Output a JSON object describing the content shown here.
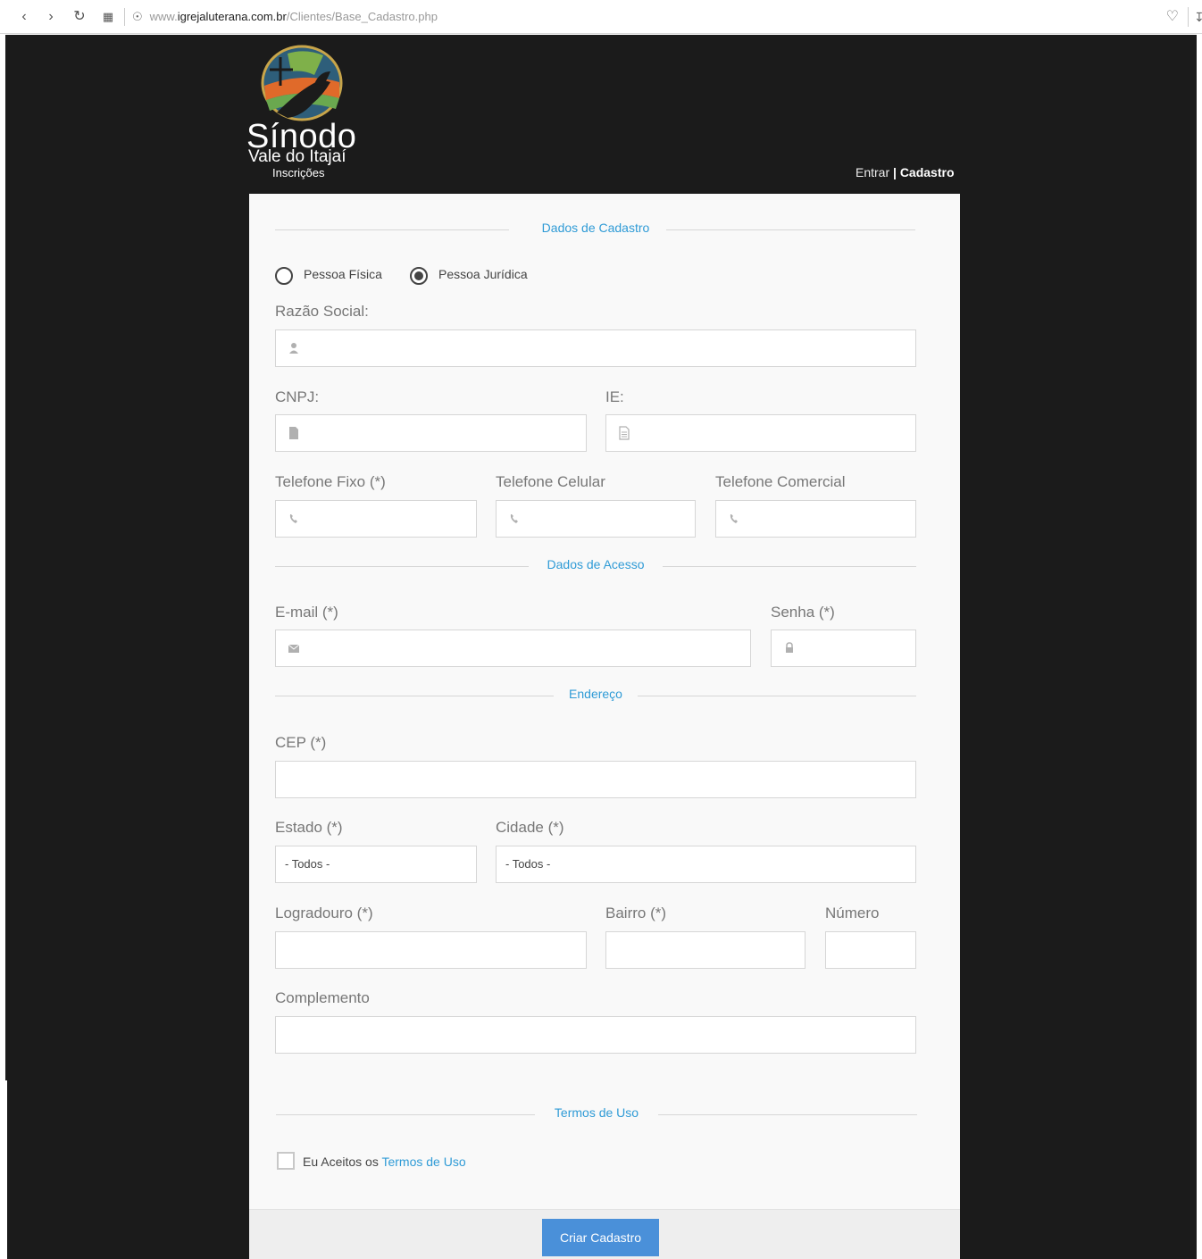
{
  "browser": {
    "url_prefix": "www.",
    "url_domain": "igrejaluterana.com.br",
    "url_path": "/Clientes/Base_Cadastro.php"
  },
  "header": {
    "logo_title": "Sínodo",
    "logo_subtitle": "Vale do Itajaí",
    "logo_small": "Inscrições",
    "link_entrar": "Entrar",
    "link_cadastro": "| Cadastro"
  },
  "sections": {
    "cadastro": "Dados de Cadastro",
    "acesso": "Dados de Acesso",
    "endereco": "Endereço",
    "termos": "Termos de Uso"
  },
  "person_type": {
    "fisica": "Pessoa Física",
    "juridica": "Pessoa Jurídica",
    "selected": "juridica"
  },
  "fields": {
    "razao_social": "Razão Social:",
    "cnpj": "CNPJ:",
    "ie": "IE:",
    "tel_fixo": "Telefone Fixo (*)",
    "tel_celular": "Telefone Celular",
    "tel_comercial": "Telefone Comercial",
    "email": "E-mail (*)",
    "senha": "Senha (*)",
    "cep": "CEP (*)",
    "estado": "Estado (*)",
    "cidade": "Cidade (*)",
    "logradouro": "Logradouro (*)",
    "bairro": "Bairro (*)",
    "numero": "Número",
    "complemento": "Complemento"
  },
  "selects": {
    "estado_value": "- Todos -",
    "cidade_value": "- Todos -"
  },
  "terms": {
    "prefix": "Eu Aceitos os",
    "link": "Termos de Uso"
  },
  "submit_label": "Criar Cadastro",
  "colors": {
    "accent": "#2f9bd6",
    "button": "#4a90d9",
    "background": "#1b1b1b",
    "card": "#f9f9f9"
  }
}
